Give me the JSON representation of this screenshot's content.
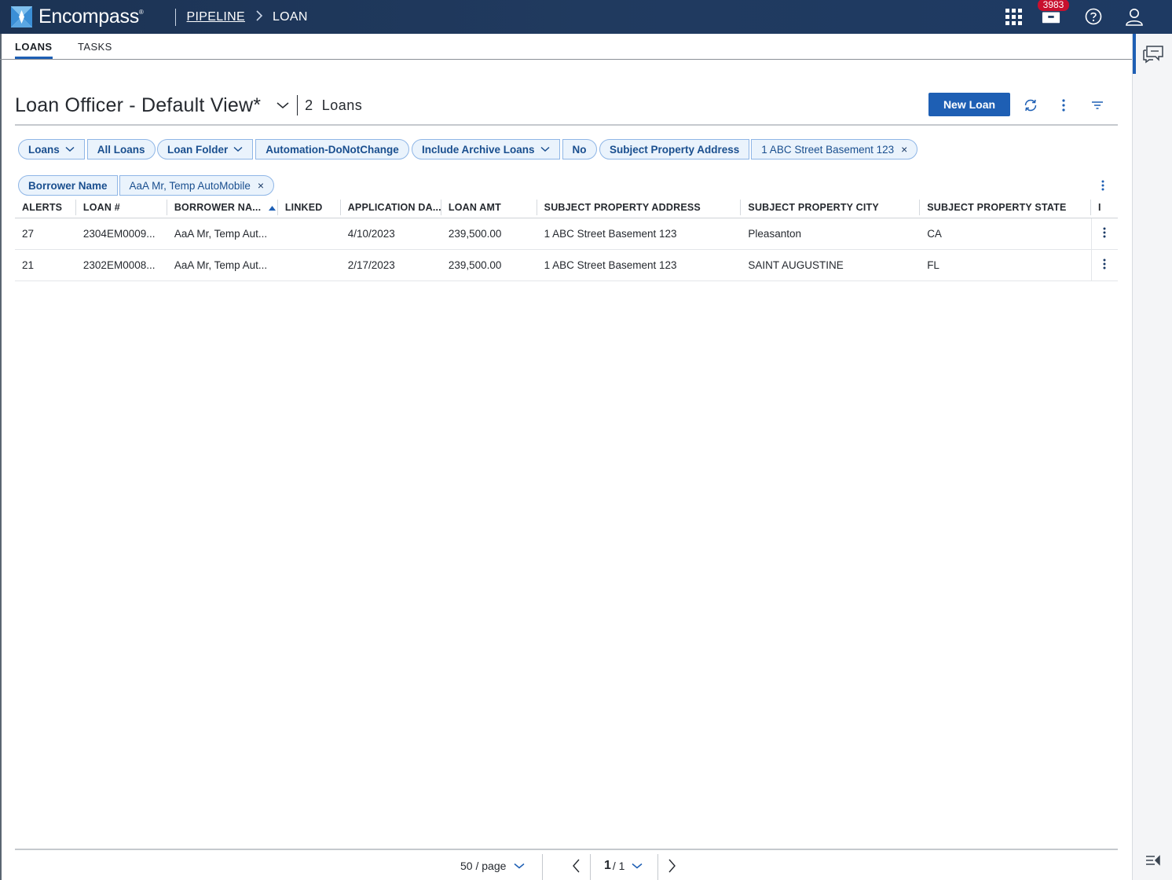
{
  "header": {
    "brand": "Encompass",
    "brand_mark": "®",
    "breadcrumb_link": "PIPELINE",
    "breadcrumb_current": "LOAN",
    "notification_count": "3983",
    "icons": [
      "apps-grid-icon",
      "inbox-icon",
      "help-icon",
      "user-icon"
    ]
  },
  "tabs": {
    "loans": "LOANS",
    "tasks": "TASKS"
  },
  "view": {
    "title": "Loan Officer - Default View*",
    "count_number": "2",
    "count_label": "Loans",
    "new_loan_label": "New Loan"
  },
  "filters": {
    "loans_label": "Loans",
    "loans_value": "All Loans",
    "folder_label": "Loan Folder",
    "folder_value": "Automation-DoNotChange",
    "archive_label": "Include Archive Loans",
    "archive_value": "No",
    "address_label": "Subject Property Address",
    "address_value": "1 ABC Street Basement 123",
    "borrower_label": "Borrower Name",
    "borrower_value": "AaA Mr, Temp AutoMobile",
    "remove_glyph": "×"
  },
  "table": {
    "columns": {
      "alerts": "ALERTS",
      "loan_number": "LOAN #",
      "borrower": "BORROWER NA...",
      "linked": "LINKED",
      "app_date": "APPLICATION DA...",
      "loan_amt": "LOAN AMT",
      "address": "SUBJECT PROPERTY ADDRESS",
      "city": "SUBJECT PROPERTY CITY",
      "state": "SUBJECT PROPERTY STATE",
      "overflow": "I"
    },
    "rows": [
      {
        "alerts": "27",
        "loan_number": "2304EM0009...",
        "borrower": "AaA Mr, Temp Aut...",
        "linked": "",
        "app_date": "4/10/2023",
        "loan_amt": "239,500.00",
        "address": "1 ABC Street Basement 123",
        "city": "Pleasanton",
        "state": "CA"
      },
      {
        "alerts": "21",
        "loan_number": "2302EM0008...",
        "borrower": "AaA Mr, Temp Aut...",
        "linked": "",
        "app_date": "2/17/2023",
        "loan_amt": "239,500.00",
        "address": "1 ABC Street Basement 123",
        "city": "SAINT AUGUSTINE",
        "state": "FL"
      }
    ]
  },
  "pagination": {
    "page_size": "50 / page",
    "current_page": "1",
    "total_pages": "/ 1"
  },
  "colors": {
    "header_bg": "#1c3354",
    "accent": "#1e5fb4",
    "badge": "#c8102e",
    "pill_bg": "#eaf3fc"
  }
}
